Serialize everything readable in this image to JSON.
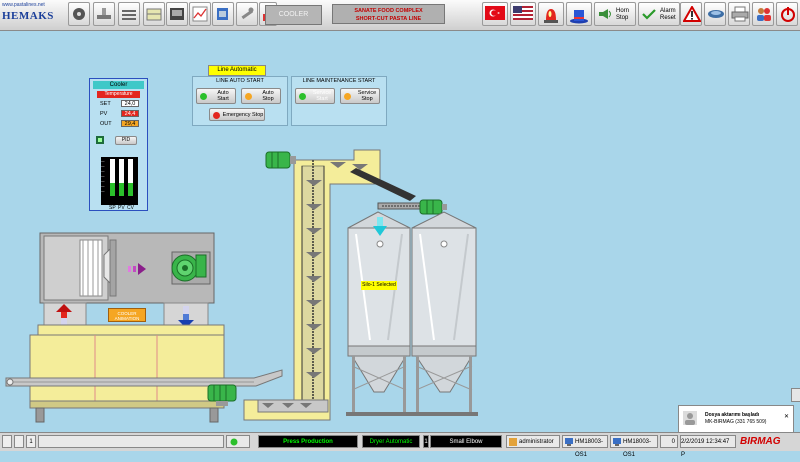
{
  "brand": {
    "url": "www.pastalines.net",
    "name": "HEMAKS"
  },
  "toolbar": {
    "screen_label": "COOLER",
    "line_title_1": "SANATE FOOD COMPLEX",
    "line_title_2": "SHORT-CUT PASTA  LINE",
    "horn_label_1": "Horn",
    "horn_label_2": "Stop",
    "alarm_label_1": "Alarm",
    "alarm_label_2": "Reset"
  },
  "line_mode": "Line Automatic",
  "auto_start": {
    "title": "LINE AUTO START",
    "auto_start_label": "Auto Start",
    "auto_stop_label": "Auto Stop",
    "emergency_label": "Emergency Stop"
  },
  "maintenance": {
    "title": "LINE MAINTENANCE START",
    "service_start_label": "Service Start",
    "service_stop_label": "Service Stop"
  },
  "cooler_panel": {
    "title": "Cooler",
    "temperature_label": "Temperature",
    "set_label": "SET",
    "set_value": "24,0",
    "pv_label": "PV",
    "pv_value": "24,4",
    "out_label": "OUT",
    "out_value": "29,4",
    "pid_label": "PID",
    "bar_labels": [
      "SP",
      "PV",
      "CV"
    ]
  },
  "cooler_animation": "COOLER ANIMATION",
  "silo_label": "Silo-1 Selected",
  "notification": {
    "title": "Dosya aktarımı başladı",
    "detail": "MK-BIRMAG (331 765 509)"
  },
  "statusbar": {
    "mode": "Press Production",
    "dryer": "Dryer Automatic",
    "product_code": "1",
    "product": "Small Elbow",
    "user": "administrator",
    "station1": "HM18003-OS1",
    "station2": "HM18003-OS1",
    "count": "0",
    "datetime": "2/2/2019 12:34:47 P",
    "logo": "BIRMAG"
  },
  "colors": {
    "background": "#a9d6ea",
    "machine_yellow": "#f4ed9a",
    "silo_gray": "#dde2e6",
    "motor_green": "#39b54a",
    "status_black": "#000000",
    "status_green": "#00ff00"
  }
}
